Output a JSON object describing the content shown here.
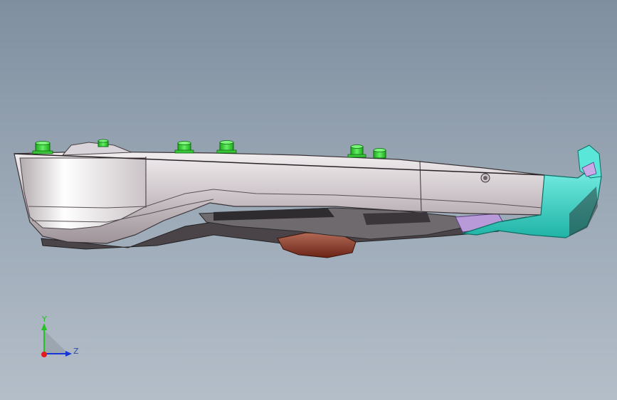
{
  "viewport": {
    "background_top": "#7f8fa0",
    "background_bottom": "#b4bec9"
  },
  "model": {
    "body_color": "#d9d3d6",
    "boss_color": "#2fd12f",
    "nose_color": "#35d6c8",
    "underside_color": "#8a3b2a"
  },
  "triad": {
    "y_label": "Y",
    "z_label": "Z",
    "y_color": "#22c322",
    "z_color": "#1a35d6",
    "x_color": "#e21c1c",
    "label_color": "#2f4fa0"
  }
}
